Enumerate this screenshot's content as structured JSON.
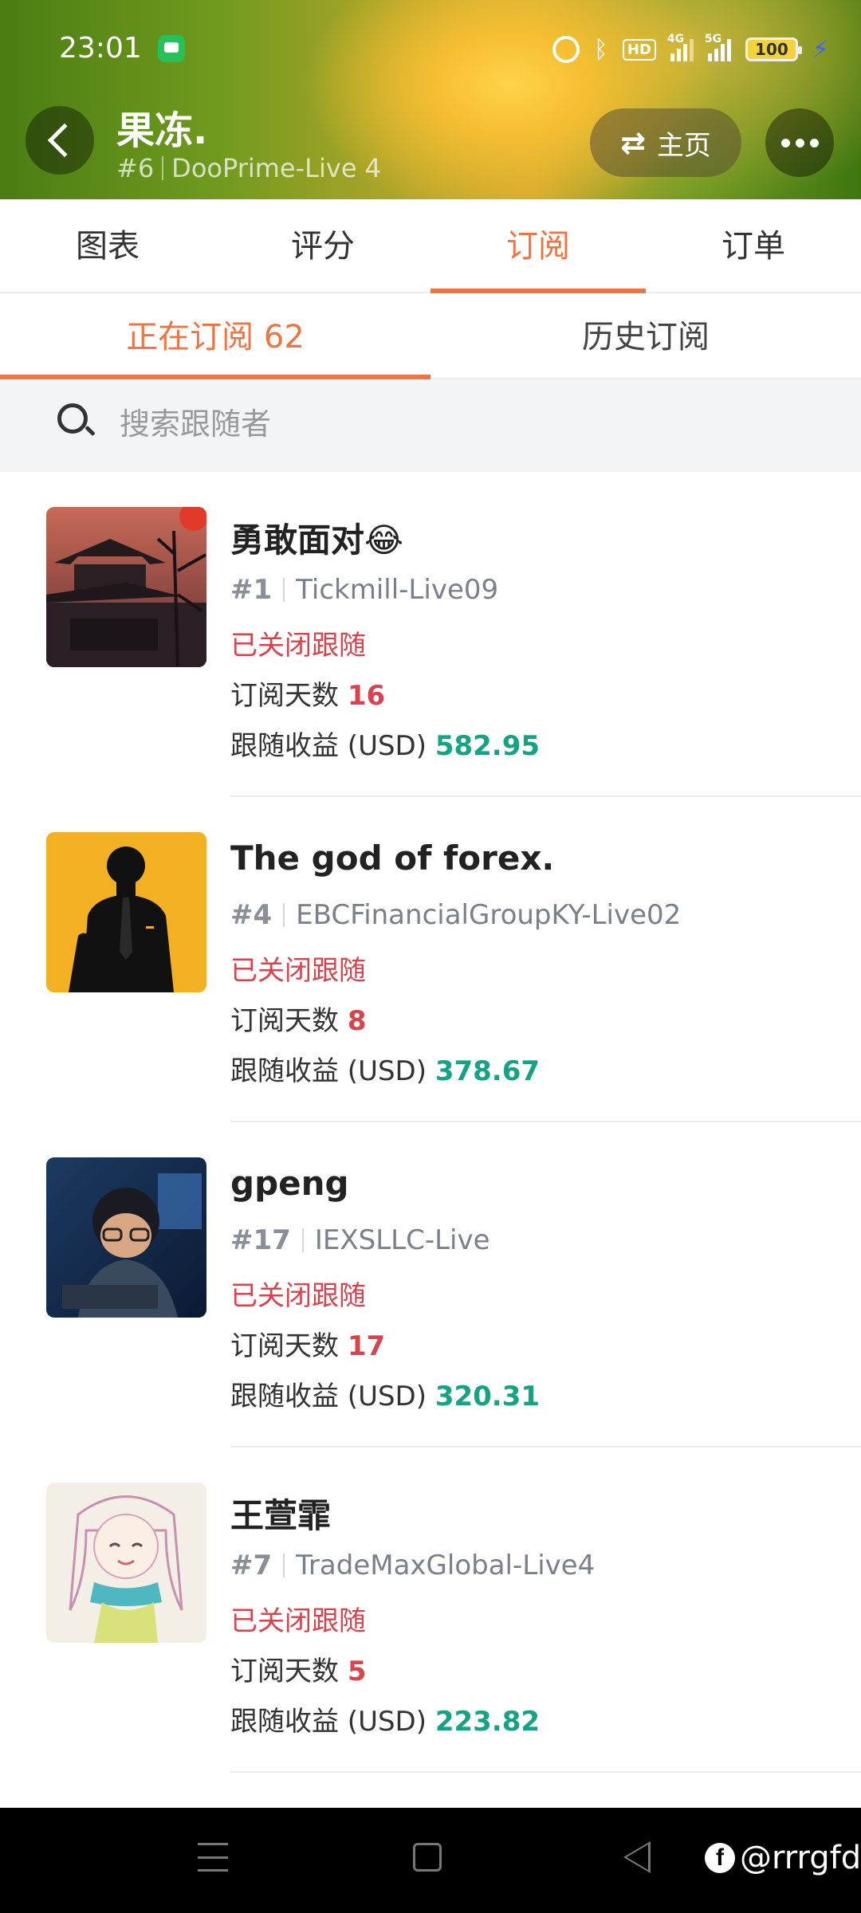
{
  "status_bar": {
    "time": "23:01",
    "hd_label": "HD",
    "network_4g": "4G",
    "network_5g": "5G",
    "battery": "100"
  },
  "header": {
    "name": "果冻.",
    "rank": "#6",
    "server": "DooPrime-Live 4",
    "home_label": "主页"
  },
  "main_tabs": [
    {
      "label": "图表",
      "active": false
    },
    {
      "label": "评分",
      "active": false
    },
    {
      "label": "订阅",
      "active": true
    },
    {
      "label": "订单",
      "active": false
    }
  ],
  "sub_tabs": [
    {
      "label": "正在订阅 62",
      "active": true
    },
    {
      "label": "历史订阅",
      "active": false
    }
  ],
  "search": {
    "placeholder": "搜索跟随者"
  },
  "labels": {
    "days": "订阅天数",
    "profit": "跟随收益 (USD)"
  },
  "subscribers": [
    {
      "name": "勇敢面对😂",
      "rank": "#1",
      "server": "Tickmill-Live09",
      "status": "已关闭跟随",
      "days": "16",
      "profit": "582.95"
    },
    {
      "name": "The god of forex.",
      "rank": "#4",
      "server": "EBCFinancialGroupKY-Live02",
      "status": "已关闭跟随",
      "days": "8",
      "profit": "378.67"
    },
    {
      "name": "gpeng",
      "rank": "#17",
      "server": "IEXSLLC-Live",
      "status": "已关闭跟随",
      "days": "17",
      "profit": "320.31"
    },
    {
      "name": "王萱霏",
      "rank": "#7",
      "server": "TradeMaxGlobal-Live4",
      "status": "已关闭跟随",
      "days": "5",
      "profit": "223.82"
    }
  ],
  "watermark": "@rrrgfd",
  "colors": {
    "accent": "#ef7444",
    "status_red": "#d9434e",
    "profit_green": "#16a383"
  }
}
